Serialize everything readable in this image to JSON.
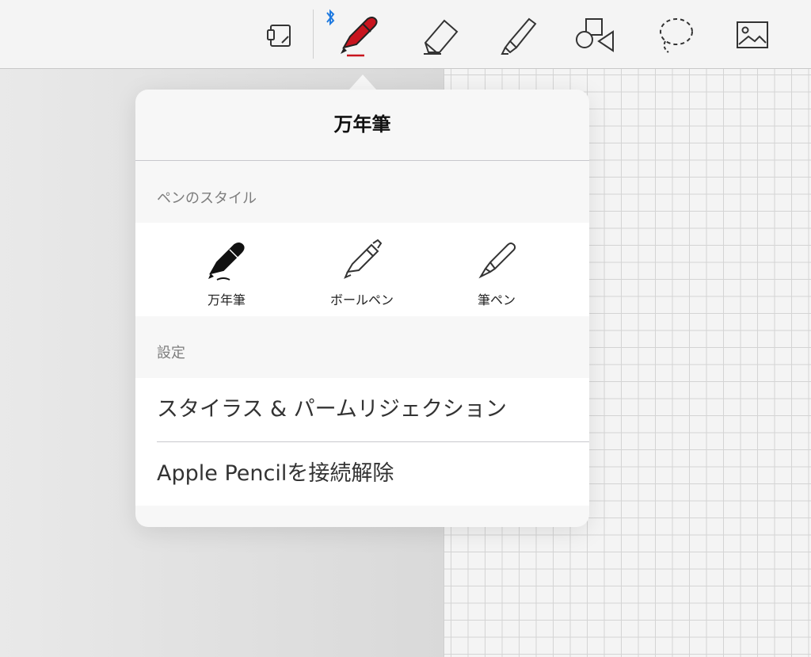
{
  "toolbar": {
    "tools": [
      {
        "id": "page-layout",
        "icon": "page-layout-icon"
      },
      {
        "id": "fountain-pen",
        "icon": "fountain-pen-icon",
        "selected": true,
        "color": "#c8141e"
      },
      {
        "id": "eraser",
        "icon": "eraser-icon"
      },
      {
        "id": "highlighter",
        "icon": "highlighter-icon"
      },
      {
        "id": "shapes",
        "icon": "shapes-icon"
      },
      {
        "id": "lasso",
        "icon": "lasso-icon"
      },
      {
        "id": "image",
        "icon": "image-icon"
      }
    ],
    "bluetooth_icon": "bluetooth-icon",
    "bluetooth_color": "#1f7ae0"
  },
  "popover": {
    "title": "万年筆",
    "pen_style_header": "ペンのスタイル",
    "pen_styles": [
      {
        "label": "万年筆",
        "icon": "fountain-pen-icon",
        "selected": true
      },
      {
        "label": "ボールペン",
        "icon": "ballpoint-pen-icon"
      },
      {
        "label": "筆ペン",
        "icon": "brush-pen-icon"
      }
    ],
    "settings_header": "設定",
    "settings": [
      {
        "label": "スタイラス & パームリジェクション"
      },
      {
        "label": "Apple Pencilを接続解除"
      }
    ]
  }
}
